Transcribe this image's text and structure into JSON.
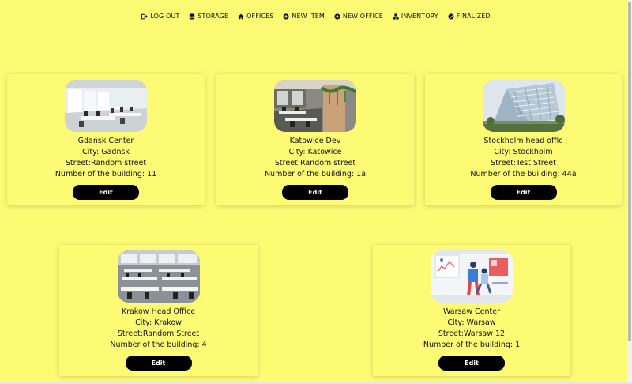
{
  "nav": {
    "items": [
      {
        "label": "LOG OUT",
        "icon": "logout-icon"
      },
      {
        "label": "STORAGE",
        "icon": "database-icon"
      },
      {
        "label": "OFFICES",
        "icon": "home-icon"
      },
      {
        "label": "NEW ITEM",
        "icon": "plus-circle-icon"
      },
      {
        "label": "NEW OFFICE",
        "icon": "plus-circle-icon"
      },
      {
        "label": "INVENTORY",
        "icon": "cubes-icon"
      },
      {
        "label": "FINALIZED",
        "icon": "check-circle-icon"
      }
    ]
  },
  "offices": [
    {
      "name": "Gdansk Center",
      "city": "City: Gadnsk",
      "street": "Street:Random street",
      "building": "Number of the building: 11",
      "edit": "Edit",
      "image": "office-interior-photo"
    },
    {
      "name": "Katowice Dev",
      "city": "City: Katowice",
      "street": "Street:Random street",
      "building": "Number of the building: 1a",
      "edit": "Edit",
      "image": "office-interior-photo"
    },
    {
      "name": "Stockholm head offic",
      "city": "City: Stockholm",
      "street": "Street:Test Street",
      "building": "Number of the building: 44a",
      "edit": "Edit",
      "image": "glass-building-photo"
    },
    {
      "name": "Krakow Head Office",
      "city": "City: Krakow",
      "street": "Street:Random Street",
      "building": "Number of the building: 4",
      "edit": "Edit",
      "image": "office-interior-photo"
    },
    {
      "name": "Warsaw Center",
      "city": "City: Warsaw",
      "street": "Street:Warsaw 12",
      "building": "Number of the building: 1",
      "edit": "Edit",
      "image": "office-illustration"
    }
  ],
  "colors": {
    "background": "#fdfb74",
    "button": "#000000",
    "button_text": "#ffffff"
  }
}
